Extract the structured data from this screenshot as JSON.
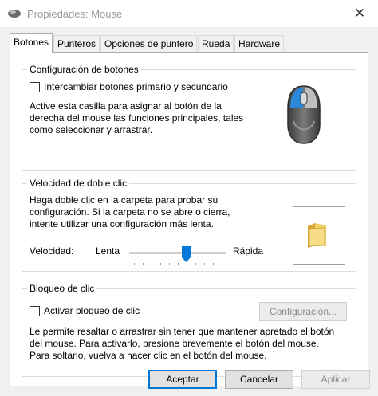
{
  "window": {
    "title": "Propiedades: Mouse",
    "close_glyph": "✕"
  },
  "tabs": [
    {
      "label": "Botones",
      "active": true
    },
    {
      "label": "Punteros"
    },
    {
      "label": "Opciones de puntero"
    },
    {
      "label": "Rueda"
    },
    {
      "label": "Hardware"
    }
  ],
  "buttons_config": {
    "heading": "Configuración de botones",
    "swap_label": "Intercambiar botones primario y secundario",
    "swap_checked": false,
    "description": [
      "Active esta casilla para asignar al botón de la",
      "derecha del mouse las funciones principales, tales",
      "como seleccionar y arrastrar."
    ]
  },
  "double_click": {
    "heading": "Velocidad de doble clic",
    "description": [
      "Haga doble clic en la carpeta para probar su",
      "configuración. Si la carpeta no se abre o cierra,",
      "intente utilizar una configuración más lenta."
    ],
    "speed_label": "Velocidad:",
    "slow_label": "Lenta",
    "fast_label": "Rápida",
    "slider_value": 0.6
  },
  "click_lock": {
    "heading": "Bloqueo de clic",
    "enable_label": "Activar bloqueo de clic",
    "enable_checked": false,
    "settings_button": "Configuración...",
    "description": [
      "Le permite resaltar o arrastrar sin tener que mantener apretado el botón",
      "del mouse. Para activarlo, presione brevemente el botón del mouse.",
      "Para soltarlo, vuelva a hacer clic en el botón del mouse."
    ]
  },
  "footer": {
    "ok": "Aceptar",
    "cancel": "Cancelar",
    "apply": "Aplicar"
  },
  "colors": {
    "accent": "#0078d7",
    "mouse_body": "#5a5a5a",
    "folder": "#e8c45c"
  }
}
